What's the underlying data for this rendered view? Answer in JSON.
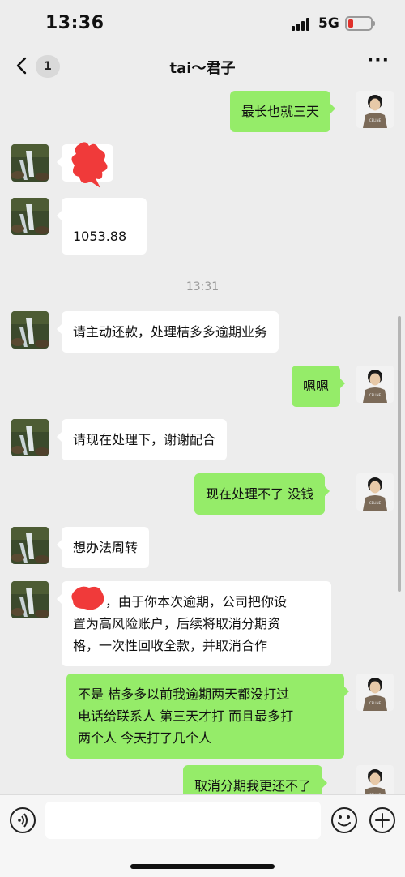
{
  "status_bar": {
    "time": "13:36",
    "network": "5G"
  },
  "nav": {
    "unread_count": "1",
    "title": "tai～君子"
  },
  "messages": [
    {
      "side": "right",
      "avatar": "self",
      "text": "最长也就三天"
    },
    {
      "side": "left",
      "avatar": "contact",
      "text": "",
      "redacted": true
    },
    {
      "side": "left",
      "avatar": "contact",
      "text": "1053.88"
    },
    {
      "side": "left",
      "avatar": "contact",
      "text": "请主动还款，处理桔多多逾期业务"
    },
    {
      "side": "right",
      "avatar": "self",
      "text": "嗯嗯"
    },
    {
      "side": "left",
      "avatar": "contact",
      "text": "请现在处理下，谢谢配合"
    },
    {
      "side": "right",
      "avatar": "self",
      "text": "现在处理不了 没钱"
    },
    {
      "side": "left",
      "avatar": "contact",
      "text": "想办法周转"
    },
    {
      "side": "left",
      "avatar": "contact",
      "lines": [
        "，由于你本次逾期，公司把你设",
        "置为高风险账户，后续将取消分期资",
        "格，一次性回收全款，并取消合作"
      ]
    },
    {
      "side": "right",
      "avatar": "self",
      "lines": [
        "不是 桔多多以前我逾期两天都没打过",
        "电话给联系人 第三天才打 而且最多打",
        "两个人 今天打了几个人"
      ]
    },
    {
      "side": "right",
      "avatar": "self",
      "text": "取消分期我更还不了"
    }
  ],
  "time_divider": "13:31",
  "shirt_text": "CELINE",
  "colors": {
    "sent_bubble": "#95ec69",
    "received_bubble": "#ffffff",
    "background": "#ededed",
    "redaction": "#f03a3a"
  },
  "icons": [
    "back-chevron-icon",
    "more-icon",
    "voice-icon",
    "emoji-icon",
    "plus-icon",
    "signal-icon",
    "battery-icon"
  ]
}
